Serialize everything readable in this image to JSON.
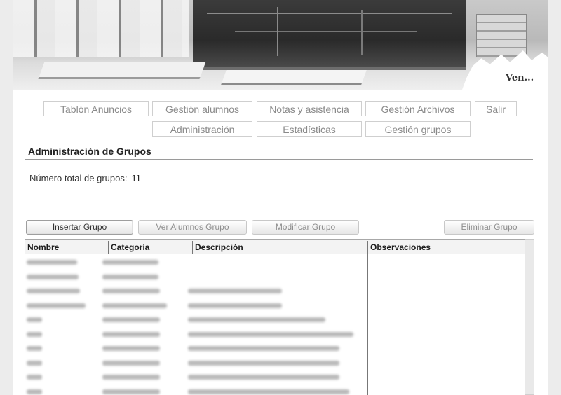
{
  "banner": {
    "caption": "Ven..."
  },
  "nav": {
    "row1": [
      "Tablón Anuncios",
      "Gestión alumnos",
      "Notas y asistencia",
      "Gestión Archivos",
      "Salir"
    ],
    "row2": [
      "Administración",
      "Estadísticas",
      "Gestión grupos"
    ]
  },
  "section": {
    "title": "Administración de Grupos",
    "total_label": "Número total de grupos:",
    "total_value": "11"
  },
  "actions": {
    "insert": "Insertar Grupo",
    "view_students": "Ver Alumnos Grupo",
    "modify": "Modificar Grupo",
    "delete": "Eliminar Grupo"
  },
  "table": {
    "columns": [
      "Nombre",
      "Categoría",
      "Descripción",
      "Observaciones"
    ],
    "rows": [
      {
        "nombre": "",
        "categoria": "",
        "descripcion": "",
        "observaciones": ""
      },
      {
        "nombre": "",
        "categoria": "",
        "descripcion": "",
        "observaciones": ""
      },
      {
        "nombre": "",
        "categoria": "",
        "descripcion": "",
        "observaciones": ""
      },
      {
        "nombre": "",
        "categoria": "",
        "descripcion": "",
        "observaciones": ""
      },
      {
        "nombre": "",
        "categoria": "",
        "descripcion": "",
        "observaciones": ""
      },
      {
        "nombre": "",
        "categoria": "",
        "descripcion": "",
        "observaciones": ""
      },
      {
        "nombre": "",
        "categoria": "",
        "descripcion": "",
        "observaciones": ""
      },
      {
        "nombre": "",
        "categoria": "",
        "descripcion": "",
        "observaciones": ""
      },
      {
        "nombre": "",
        "categoria": "",
        "descripcion": "",
        "observaciones": ""
      },
      {
        "nombre": "",
        "categoria": "",
        "descripcion": "",
        "observaciones": ""
      },
      {
        "nombre": "",
        "categoria": "",
        "descripcion": "",
        "observaciones": ""
      }
    ]
  }
}
